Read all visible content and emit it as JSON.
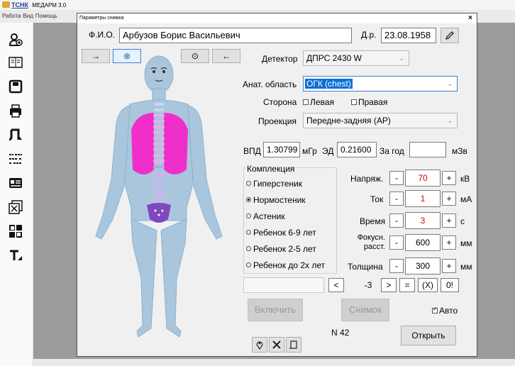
{
  "app": {
    "brand": "ТСНК",
    "title": "МЕДАРМ 3.0",
    "menu": [
      "Работа",
      "Вид",
      "Помощь"
    ]
  },
  "dialog": {
    "title": "Параметры снимка",
    "close": "×"
  },
  "patient": {
    "fio_label": "Ф.И.О.",
    "fio": "Арбузов Борис Васильевич",
    "dob_label": "Д.р.",
    "dob": "23.08.1958"
  },
  "body_toolbar": {
    "left_arrow": "→",
    "cancel": "⊗",
    "center": "⊙",
    "right_arrow": "←"
  },
  "detector": {
    "label": "Детектор",
    "value": "ДПРС 2430 W"
  },
  "anat": {
    "label": "Анат. область",
    "value": "ОГК (chest)"
  },
  "side": {
    "label": "Сторона",
    "left": "Левая",
    "right": "Правая"
  },
  "projection": {
    "label": "Проекция",
    "value": "Передне-задняя (AP)"
  },
  "dose": {
    "vpd_label": "ВПД",
    "vpd": "1.30799",
    "vpd_unit": "мГр",
    "ed_label": "ЭД",
    "ed": "0.21600",
    "year_label": "За год",
    "year": "",
    "year_unit": "мЗв"
  },
  "build": {
    "title": "Комплекция",
    "options": [
      "Гиперстеник",
      "Нормостеник",
      "Астеник",
      "Ребенок 6-9 лет",
      "Ребенок 2-5 лет",
      "Ребенок до 2х лет"
    ],
    "selected": "Нормостеник"
  },
  "params": {
    "voltage": {
      "label": "Напряж.",
      "value": "70",
      "unit": "кВ"
    },
    "current": {
      "label": "Ток",
      "value": "1",
      "unit": "мА"
    },
    "time": {
      "label": "Время",
      "value": "3",
      "unit": "с"
    },
    "focus": {
      "label1": "Фокусн.",
      "label2": "расст.",
      "value": "600",
      "unit": "мм"
    },
    "thickness": {
      "label": "Толщина",
      "value": "300",
      "unit": "мм"
    },
    "minus": "-",
    "plus": "+"
  },
  "calc": {
    "lt": "<",
    "value": "-3",
    "gt": ">",
    "eq": "=",
    "x": "(X)",
    "zero": "0!"
  },
  "actions": {
    "enable": "Включить",
    "shot": "Снимок",
    "auto": "Авто",
    "number": "N 42",
    "open": "Открыть"
  }
}
